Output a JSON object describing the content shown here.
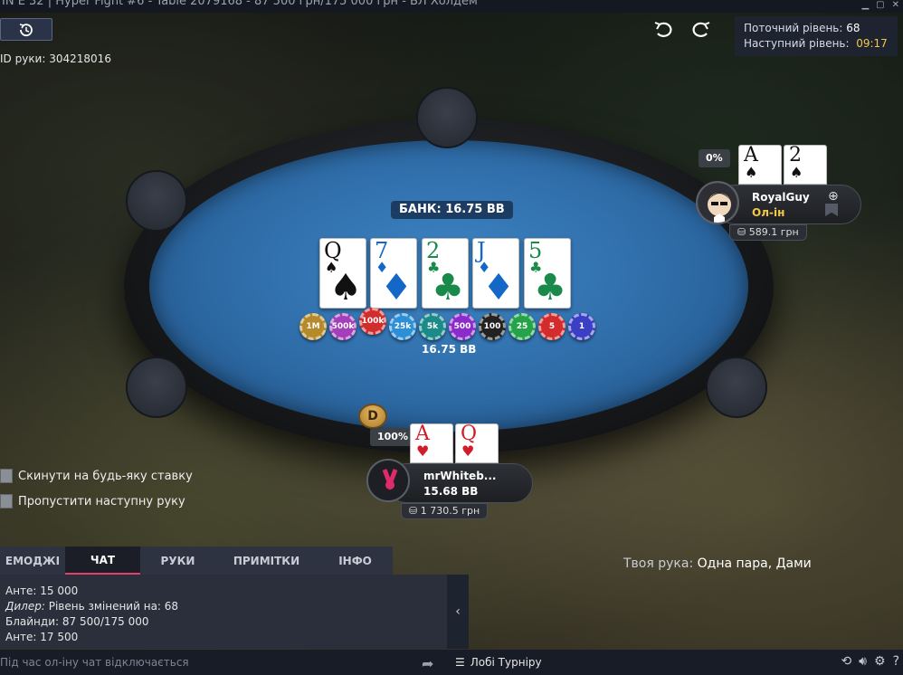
{
  "window": {
    "title": "ÎN E 32 | Hyper Fight #6 - Table 2079168 - 87 500 грн/175 000 грн - БЛ Холдем"
  },
  "hand": {
    "id_label": "ID руки:",
    "id": "304218016"
  },
  "level": {
    "current_label": "Поточний рівень:",
    "current_value": "68",
    "next_label": "Наступний рівень:",
    "next_value": "09:17"
  },
  "pot": {
    "label": "БАНК: 16.75 BB",
    "below": "16.75 BB"
  },
  "board": [
    {
      "rank": "Q",
      "suit": "♠",
      "color": "black"
    },
    {
      "rank": "7",
      "suit": "♦",
      "color": "blue"
    },
    {
      "rank": "2",
      "suit": "♣",
      "color": "green"
    },
    {
      "rank": "J",
      "suit": "♦",
      "color": "blue"
    },
    {
      "rank": "5",
      "suit": "♣",
      "color": "green"
    }
  ],
  "chips": [
    {
      "label": "1M",
      "color": "#b58a2a"
    },
    {
      "label": "500k",
      "color": "#a33fb8"
    },
    {
      "label": "100k",
      "color": "#d22c2c"
    },
    {
      "label": "25k",
      "color": "#2d8fd6"
    },
    {
      "label": "5k",
      "color": "#1d8a8a"
    },
    {
      "label": "500",
      "color": "#8b2bc9"
    },
    {
      "label": "100",
      "color": "#222222"
    },
    {
      "label": "25",
      "color": "#25a34a"
    },
    {
      "label": "5",
      "color": "#d22c2c"
    },
    {
      "label": "1",
      "color": "#3b3fc4"
    }
  ],
  "opponent": {
    "name": "RoyalGuy",
    "status": "Ол-ін",
    "stack": "589.1 грн",
    "equity": "0%",
    "cards": [
      {
        "rank": "A",
        "suit": "♠"
      },
      {
        "rank": "2",
        "suit": "♠"
      }
    ]
  },
  "hero": {
    "name": "mrWhiteb...",
    "stack_bb": "15.68 BB",
    "stack": "1 730.5 грн",
    "equity": "100%",
    "avatar_text": "vbet",
    "cards": [
      {
        "rank": "A",
        "suit": "♥"
      },
      {
        "rank": "Q",
        "suit": "♥"
      }
    ]
  },
  "dealer_button": "D",
  "options": [
    "Скинути на будь-яку ставку",
    "Пропустити наступну руку"
  ],
  "my_hand": {
    "label": "Твоя рука:",
    "value": "Одна пара, Дами"
  },
  "tabs": [
    {
      "label": "ЕМОДЖІ",
      "active": false
    },
    {
      "label": "ЧАТ",
      "active": true
    },
    {
      "label": "РУКИ",
      "active": false
    },
    {
      "label": "ПРИМІТКИ",
      "active": false
    },
    {
      "label": "ІНФО",
      "active": false
    }
  ],
  "chat": [
    {
      "label": "",
      "text": "Анте: 15 000"
    },
    {
      "label": "Дилер:",
      "text": " Рівень змінений на: 68"
    },
    {
      "label": "",
      "text": "Блайнди: 87 500/175 000"
    },
    {
      "label": "",
      "text": "Анте: 17 500"
    }
  ],
  "chat_input_placeholder": "Під час ол-іну чат відключається",
  "lobby_label": "Лобі Турніру",
  "icons": {
    "history": "history-icon",
    "undo": "undo-icon",
    "redo": "redo-icon",
    "send": "send-arrow-icon",
    "lobby": "list-icon",
    "settings": "gear-icon",
    "sound": "speaker-icon",
    "help": "help-icon"
  }
}
